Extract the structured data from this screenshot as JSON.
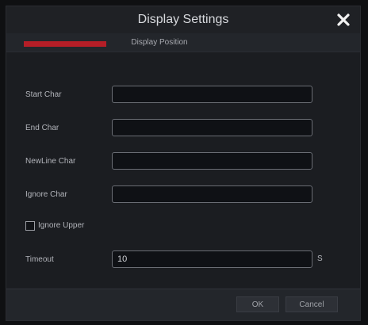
{
  "window": {
    "title": "Display Settings",
    "close_icon": "close-icon"
  },
  "tabs": [
    {
      "label": "",
      "active": true,
      "accent": "#b51e27"
    },
    {
      "label": "Display Position",
      "active": false
    }
  ],
  "form": {
    "start_char": {
      "label": "Start Char",
      "value": ""
    },
    "end_char": {
      "label": "End Char",
      "value": ""
    },
    "newline_char": {
      "label": "NewLine Char",
      "value": ""
    },
    "ignore_char": {
      "label": "Ignore Char",
      "value": ""
    },
    "ignore_upper": {
      "label": "Ignore Upper",
      "checked": false
    },
    "timeout": {
      "label": "Timeout",
      "value": "10",
      "unit": "S"
    }
  },
  "footer": {
    "ok_label": "OK",
    "cancel_label": "Cancel"
  }
}
